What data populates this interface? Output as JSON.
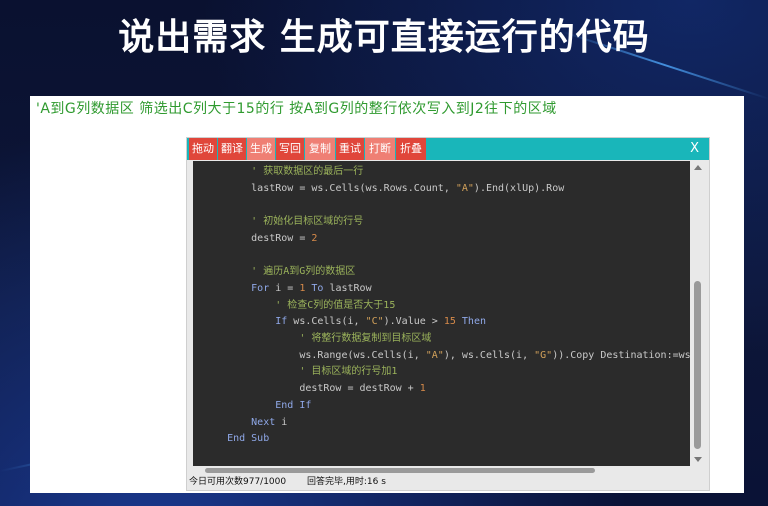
{
  "headline": "说出需求 生成可直接运行的代码",
  "prompt_text": "'A到G列数据区 筛选出C列大于15的行 按A到G列的整行依次写入到J2往下的区域",
  "toolbar": {
    "buttons": [
      {
        "label": "拖动",
        "color": "#e0463a"
      },
      {
        "label": "翻译",
        "color": "#e0463a"
      },
      {
        "label": "生成",
        "color": "#ef7f74"
      },
      {
        "label": "写回",
        "color": "#e0463a"
      },
      {
        "label": "复制",
        "color": "#ef7f74"
      },
      {
        "label": "重试",
        "color": "#e0463a"
      },
      {
        "label": "打断",
        "color": "#ef7f74"
      },
      {
        "label": "折叠",
        "color": "#e0463a"
      }
    ],
    "close_label": "X",
    "bar_color": "#19b6ba"
  },
  "code": {
    "lines": [
      {
        "indent": 8,
        "segs": [
          {
            "t": "' 获取数据区的最后一行",
            "c": "comment"
          }
        ]
      },
      {
        "indent": 8,
        "segs": [
          {
            "t": "lastRow = ws.Cells(ws.Rows.Count, ",
            "c": "plain"
          },
          {
            "t": "\"A\"",
            "c": "str"
          },
          {
            "t": ").End(xlUp).Row",
            "c": "plain"
          }
        ]
      },
      {
        "indent": 0,
        "segs": []
      },
      {
        "indent": 8,
        "segs": [
          {
            "t": "' 初始化目标区域的行号",
            "c": "comment"
          }
        ]
      },
      {
        "indent": 8,
        "segs": [
          {
            "t": "destRow = ",
            "c": "plain"
          },
          {
            "t": "2",
            "c": "num"
          }
        ]
      },
      {
        "indent": 0,
        "segs": []
      },
      {
        "indent": 8,
        "segs": [
          {
            "t": "' 遍历A到G列的数据区",
            "c": "comment"
          }
        ]
      },
      {
        "indent": 8,
        "segs": [
          {
            "t": "For",
            "c": "kw"
          },
          {
            "t": " i = ",
            "c": "plain"
          },
          {
            "t": "1",
            "c": "num"
          },
          {
            "t": " To",
            "c": "kw"
          },
          {
            "t": " lastRow",
            "c": "plain"
          }
        ]
      },
      {
        "indent": 12,
        "segs": [
          {
            "t": "' 检查C列的值是否大于15",
            "c": "comment"
          }
        ]
      },
      {
        "indent": 12,
        "segs": [
          {
            "t": "If",
            "c": "kw"
          },
          {
            "t": " ws.Cells(i, ",
            "c": "plain"
          },
          {
            "t": "\"C\"",
            "c": "str"
          },
          {
            "t": ").Value > ",
            "c": "plain"
          },
          {
            "t": "15",
            "c": "num"
          },
          {
            "t": " Then",
            "c": "kw"
          }
        ]
      },
      {
        "indent": 16,
        "segs": [
          {
            "t": "' 将整行数据复制到目标区域",
            "c": "comment"
          }
        ]
      },
      {
        "indent": 16,
        "segs": [
          {
            "t": "ws.Range(ws.Cells(i, ",
            "c": "plain"
          },
          {
            "t": "\"A\"",
            "c": "str"
          },
          {
            "t": "), ws.Cells(i, ",
            "c": "plain"
          },
          {
            "t": "\"G\"",
            "c": "str"
          },
          {
            "t": ")).Copy Destination:=ws.Ce",
            "c": "plain"
          }
        ]
      },
      {
        "indent": 16,
        "segs": [
          {
            "t": "' 目标区域的行号加1",
            "c": "comment"
          }
        ]
      },
      {
        "indent": 16,
        "segs": [
          {
            "t": "destRow = destRow + ",
            "c": "plain"
          },
          {
            "t": "1",
            "c": "num"
          }
        ]
      },
      {
        "indent": 12,
        "segs": [
          {
            "t": "End If",
            "c": "kw"
          }
        ]
      },
      {
        "indent": 8,
        "segs": [
          {
            "t": "Next",
            "c": "kw"
          },
          {
            "t": " i",
            "c": "plain"
          }
        ]
      },
      {
        "indent": 4,
        "segs": [
          {
            "t": "End Sub",
            "c": "kw"
          }
        ]
      }
    ]
  },
  "status": {
    "usage": "今日可用次数977/1000",
    "answer": "回答完毕,用时:16 s"
  }
}
